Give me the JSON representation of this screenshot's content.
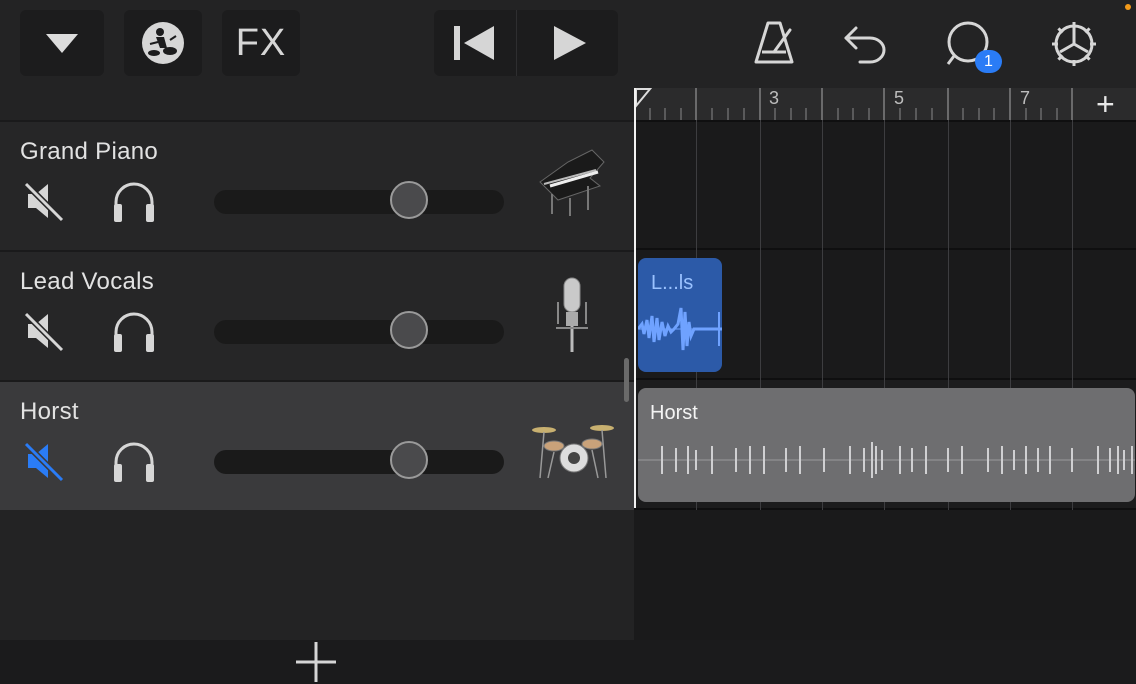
{
  "toolbar": {
    "fx_label": "FX",
    "notification_count": "1",
    "icons": [
      "triangle-down-icon",
      "drummer-icon",
      "skip-back-icon",
      "play-icon",
      "metronome-icon",
      "undo-icon",
      "loop-icon",
      "gear-icon"
    ]
  },
  "tracks": [
    {
      "name": "Grand Piano",
      "muted": false,
      "volume": 0.7,
      "instrument_icon": "grand-piano-icon"
    },
    {
      "name": "Lead Vocals",
      "muted": false,
      "volume": 0.7,
      "instrument_icon": "microphone-icon"
    },
    {
      "name": "Horst",
      "muted": true,
      "volume": 0.7,
      "instrument_icon": "drum-kit-icon",
      "selected": true
    }
  ],
  "ruler": {
    "labels": [
      "3",
      "5",
      "7"
    ],
    "add_label": "+"
  },
  "regions": {
    "vocals_label": "L...ls",
    "drums_label": "Horst"
  },
  "colors": {
    "accent_blue": "#2a7cf6",
    "region_blue": "#2c5aa8",
    "region_gray": "#6e6e70",
    "badge": "#2a7cf6"
  }
}
